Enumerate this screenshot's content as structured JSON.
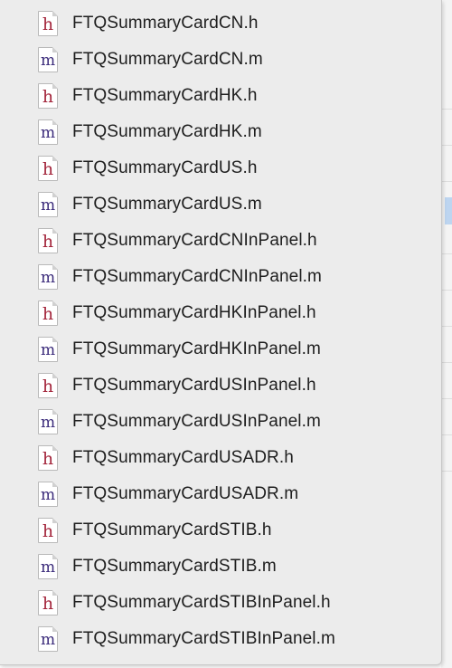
{
  "files": [
    {
      "name": "FTQSummaryCardCN.h",
      "type": "h",
      "glyph": "h"
    },
    {
      "name": "FTQSummaryCardCN.m",
      "type": "m",
      "glyph": "m"
    },
    {
      "name": "FTQSummaryCardHK.h",
      "type": "h",
      "glyph": "h"
    },
    {
      "name": "FTQSummaryCardHK.m",
      "type": "m",
      "glyph": "m"
    },
    {
      "name": "FTQSummaryCardUS.h",
      "type": "h",
      "glyph": "h"
    },
    {
      "name": "FTQSummaryCardUS.m",
      "type": "m",
      "glyph": "m"
    },
    {
      "name": "FTQSummaryCardCNInPanel.h",
      "type": "h",
      "glyph": "h"
    },
    {
      "name": "FTQSummaryCardCNInPanel.m",
      "type": "m",
      "glyph": "m"
    },
    {
      "name": "FTQSummaryCardHKInPanel.h",
      "type": "h",
      "glyph": "h"
    },
    {
      "name": "FTQSummaryCardHKInPanel.m",
      "type": "m",
      "glyph": "m"
    },
    {
      "name": "FTQSummaryCardUSInPanel.h",
      "type": "h",
      "glyph": "h"
    },
    {
      "name": "FTQSummaryCardUSInPanel.m",
      "type": "m",
      "glyph": "m"
    },
    {
      "name": "FTQSummaryCardUSADR.h",
      "type": "h",
      "glyph": "h"
    },
    {
      "name": "FTQSummaryCardUSADR.m",
      "type": "m",
      "glyph": "m"
    },
    {
      "name": "FTQSummaryCardSTIB.h",
      "type": "h",
      "glyph": "h"
    },
    {
      "name": "FTQSummaryCardSTIB.m",
      "type": "m",
      "glyph": "m"
    },
    {
      "name": "FTQSummaryCardSTIBInPanel.h",
      "type": "h",
      "glyph": "h"
    },
    {
      "name": "FTQSummaryCardSTIBInPanel.m",
      "type": "m",
      "glyph": "m"
    }
  ],
  "colors": {
    "header_icon": "#a3253b",
    "implementation_icon": "#3a2a7a",
    "text": "#1e1e1e",
    "popup_background": "#ececec"
  }
}
